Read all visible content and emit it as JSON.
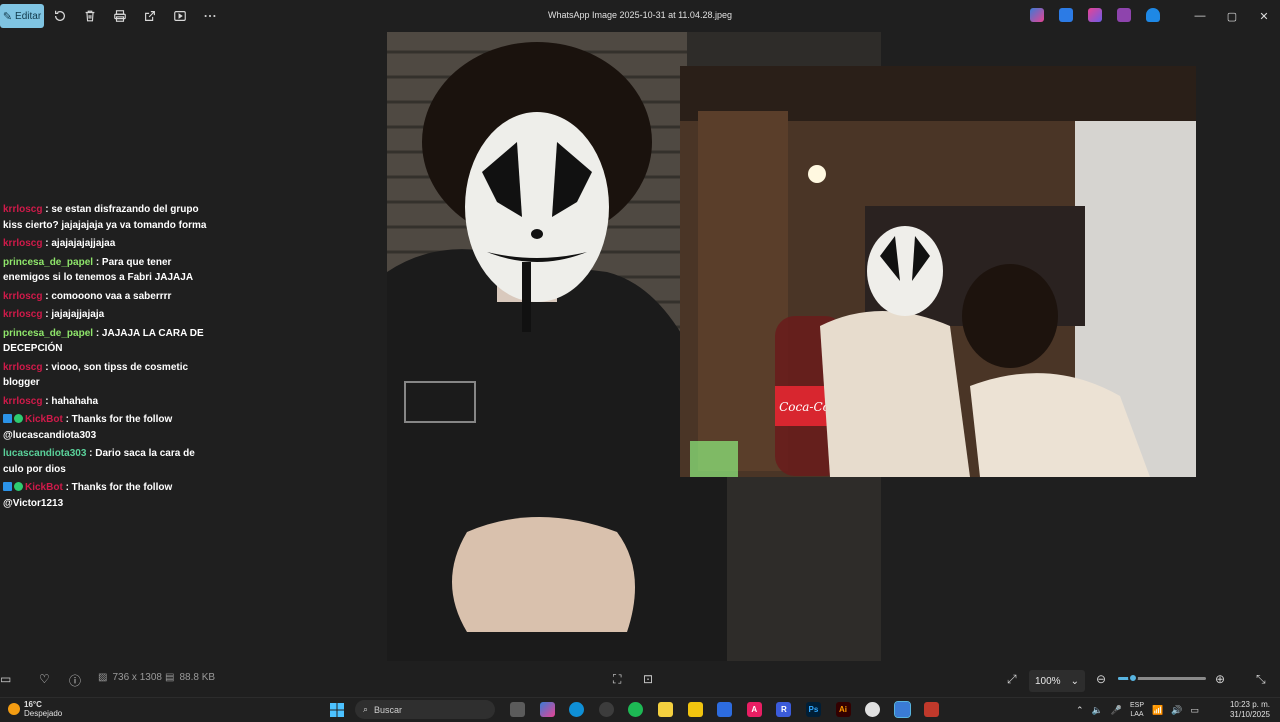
{
  "toolbar": {
    "edit_label": "Editar",
    "icons": [
      "rotate-icon",
      "delete-icon",
      "print-icon",
      "share-icon",
      "slideshow-icon",
      "more-icon"
    ]
  },
  "window": {
    "title": "WhatsApp Image 2025-10-31 at 11.04.28.jpeg"
  },
  "chat": {
    "messages": [
      {
        "user": "krrloscg",
        "text": " : se estan disfrazando del grupo kiss cierto? jajajajaja ya va tomando forma",
        "color": "#d01a4a"
      },
      {
        "user": "krrloscg",
        "text": " : ajajajajajjajaa",
        "color": "#d01a4a"
      },
      {
        "user": "princesa_de_papel",
        "text": " : Para que tener enemigos si lo tenemos a Fabri JAJAJA",
        "color": "#8fe66b"
      },
      {
        "user": "krrloscg",
        "text": " : comooono vaa a saberrrr",
        "color": "#d01a4a"
      },
      {
        "user": "krrloscg",
        "text": " : jajajajjajaja",
        "color": "#d01a4a"
      },
      {
        "user": "princesa_de_papel",
        "text": " : JAJAJA LA CARA DE DECEPCIÓN",
        "color": "#8fe66b"
      },
      {
        "user": "krrloscg",
        "text": " : viooo, son tipss de cosmetic blogger",
        "color": "#d01a4a"
      },
      {
        "user": "krrloscg",
        "text": " : hahahaha",
        "color": "#d01a4a"
      },
      {
        "user": "KickBot",
        "text": " : Thanks for the follow @lucascandiota303",
        "color": "#d01a4a",
        "badges": true
      },
      {
        "user": "lucascandiota303",
        "text": " : Dario saca la cara de culo por dios",
        "color": "#5ad19a"
      },
      {
        "user": "KickBot",
        "text": " : Thanks for the follow @Victor1213",
        "color": "#d01a4a",
        "badges": true
      }
    ]
  },
  "infobar": {
    "dimensions": "736 x 1308",
    "filesize": "88.8 KB",
    "zoom": "100%",
    "zoom_level": 0.17
  },
  "taskbar": {
    "weather_temp": "16°C",
    "weather_desc": "Despejado",
    "search_placeholder": "Buscar",
    "lang_top": "ESP",
    "lang_bottom": "LAA",
    "time": "10:23 p. m.",
    "date": "31/10/2025"
  }
}
